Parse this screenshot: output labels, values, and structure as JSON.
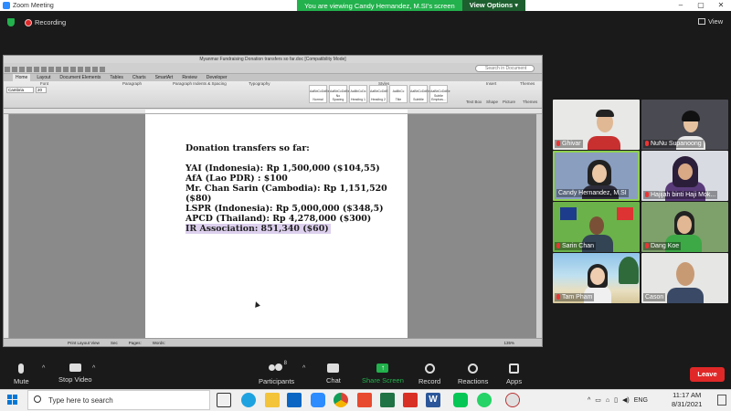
{
  "window": {
    "title": "Zoom Meeting"
  },
  "banner": {
    "text": "You are viewing Candy Hernandez, M.SI's screen",
    "view_options": "View Options ▾"
  },
  "recording": {
    "label": "Recording"
  },
  "view_button": {
    "label": "View"
  },
  "word": {
    "title": "Myanmar Fundraising Donation transfers so far.doc [Compatibility Mode]",
    "search_placeholder": "Search in Document",
    "ribbon_tabs": [
      "Home",
      "Layout",
      "Document Elements",
      "Tables",
      "Charts",
      "SmartArt",
      "Review",
      "Developer"
    ],
    "ribbon_groups": [
      "Font",
      "Paragraph",
      "Paragraph Indents & Spacing",
      "Typography",
      "Styles",
      "Insert",
      "Themes"
    ],
    "font_name": "Cambria",
    "font_size": "20",
    "styles": [
      "Normal",
      "No Spacing",
      "Heading 1",
      "Heading 2",
      "Title",
      "Subtitle",
      "Subtle Emphas..."
    ],
    "insert_buttons": [
      "Text Box",
      "Shape",
      "Picture",
      "Themes"
    ],
    "status": {
      "view": "Print Layout View",
      "sec": "Sec",
      "pages": "Pages:",
      "words": "Words:",
      "zoom": "135%"
    },
    "doc_lines": {
      "heading": "Donation transfers so far:",
      "l1": "YAI (Indonesia): Rp 1,500,000 ($104,55)",
      "l2": "AfA (Lao PDR) : $100",
      "l3": "Mr. Chan Sarin (Cambodia): Rp 1,151,520",
      "l4": "($80)",
      "l5": "LSPR (Indonesia): Rp 5,000,000 ($348,5)",
      "l6": "APCD (Thailand): Rp 4,278,000 ($300)",
      "l7": "IR Association: 851,340 ($60)"
    }
  },
  "participants": [
    {
      "name": "Ghivar"
    },
    {
      "name": "NuNu Supanoong"
    },
    {
      "name": "Candy Hernandez, M.SI"
    },
    {
      "name": "Hajijah binti Haji Mok..."
    },
    {
      "name": "Sarin Chan"
    },
    {
      "name": "Dang Koe"
    },
    {
      "name": "Tam Pham"
    },
    {
      "name": "Cason"
    }
  ],
  "controls": {
    "mute": "Mute",
    "stop_video": "Stop Video",
    "participants": "Participants",
    "participants_count": "8",
    "chat": "Chat",
    "share_screen": "Share Screen",
    "record": "Record",
    "reactions": "Reactions",
    "apps": "Apps",
    "leave": "Leave"
  },
  "taskbar": {
    "search_placeholder": "Type here to search",
    "lang": "ENG",
    "time": "11:17 AM",
    "date": "8/31/2021"
  },
  "colors": {
    "share_green": "#22b14c",
    "leave_red": "#e02828",
    "highlight": "#ddd0ee"
  }
}
